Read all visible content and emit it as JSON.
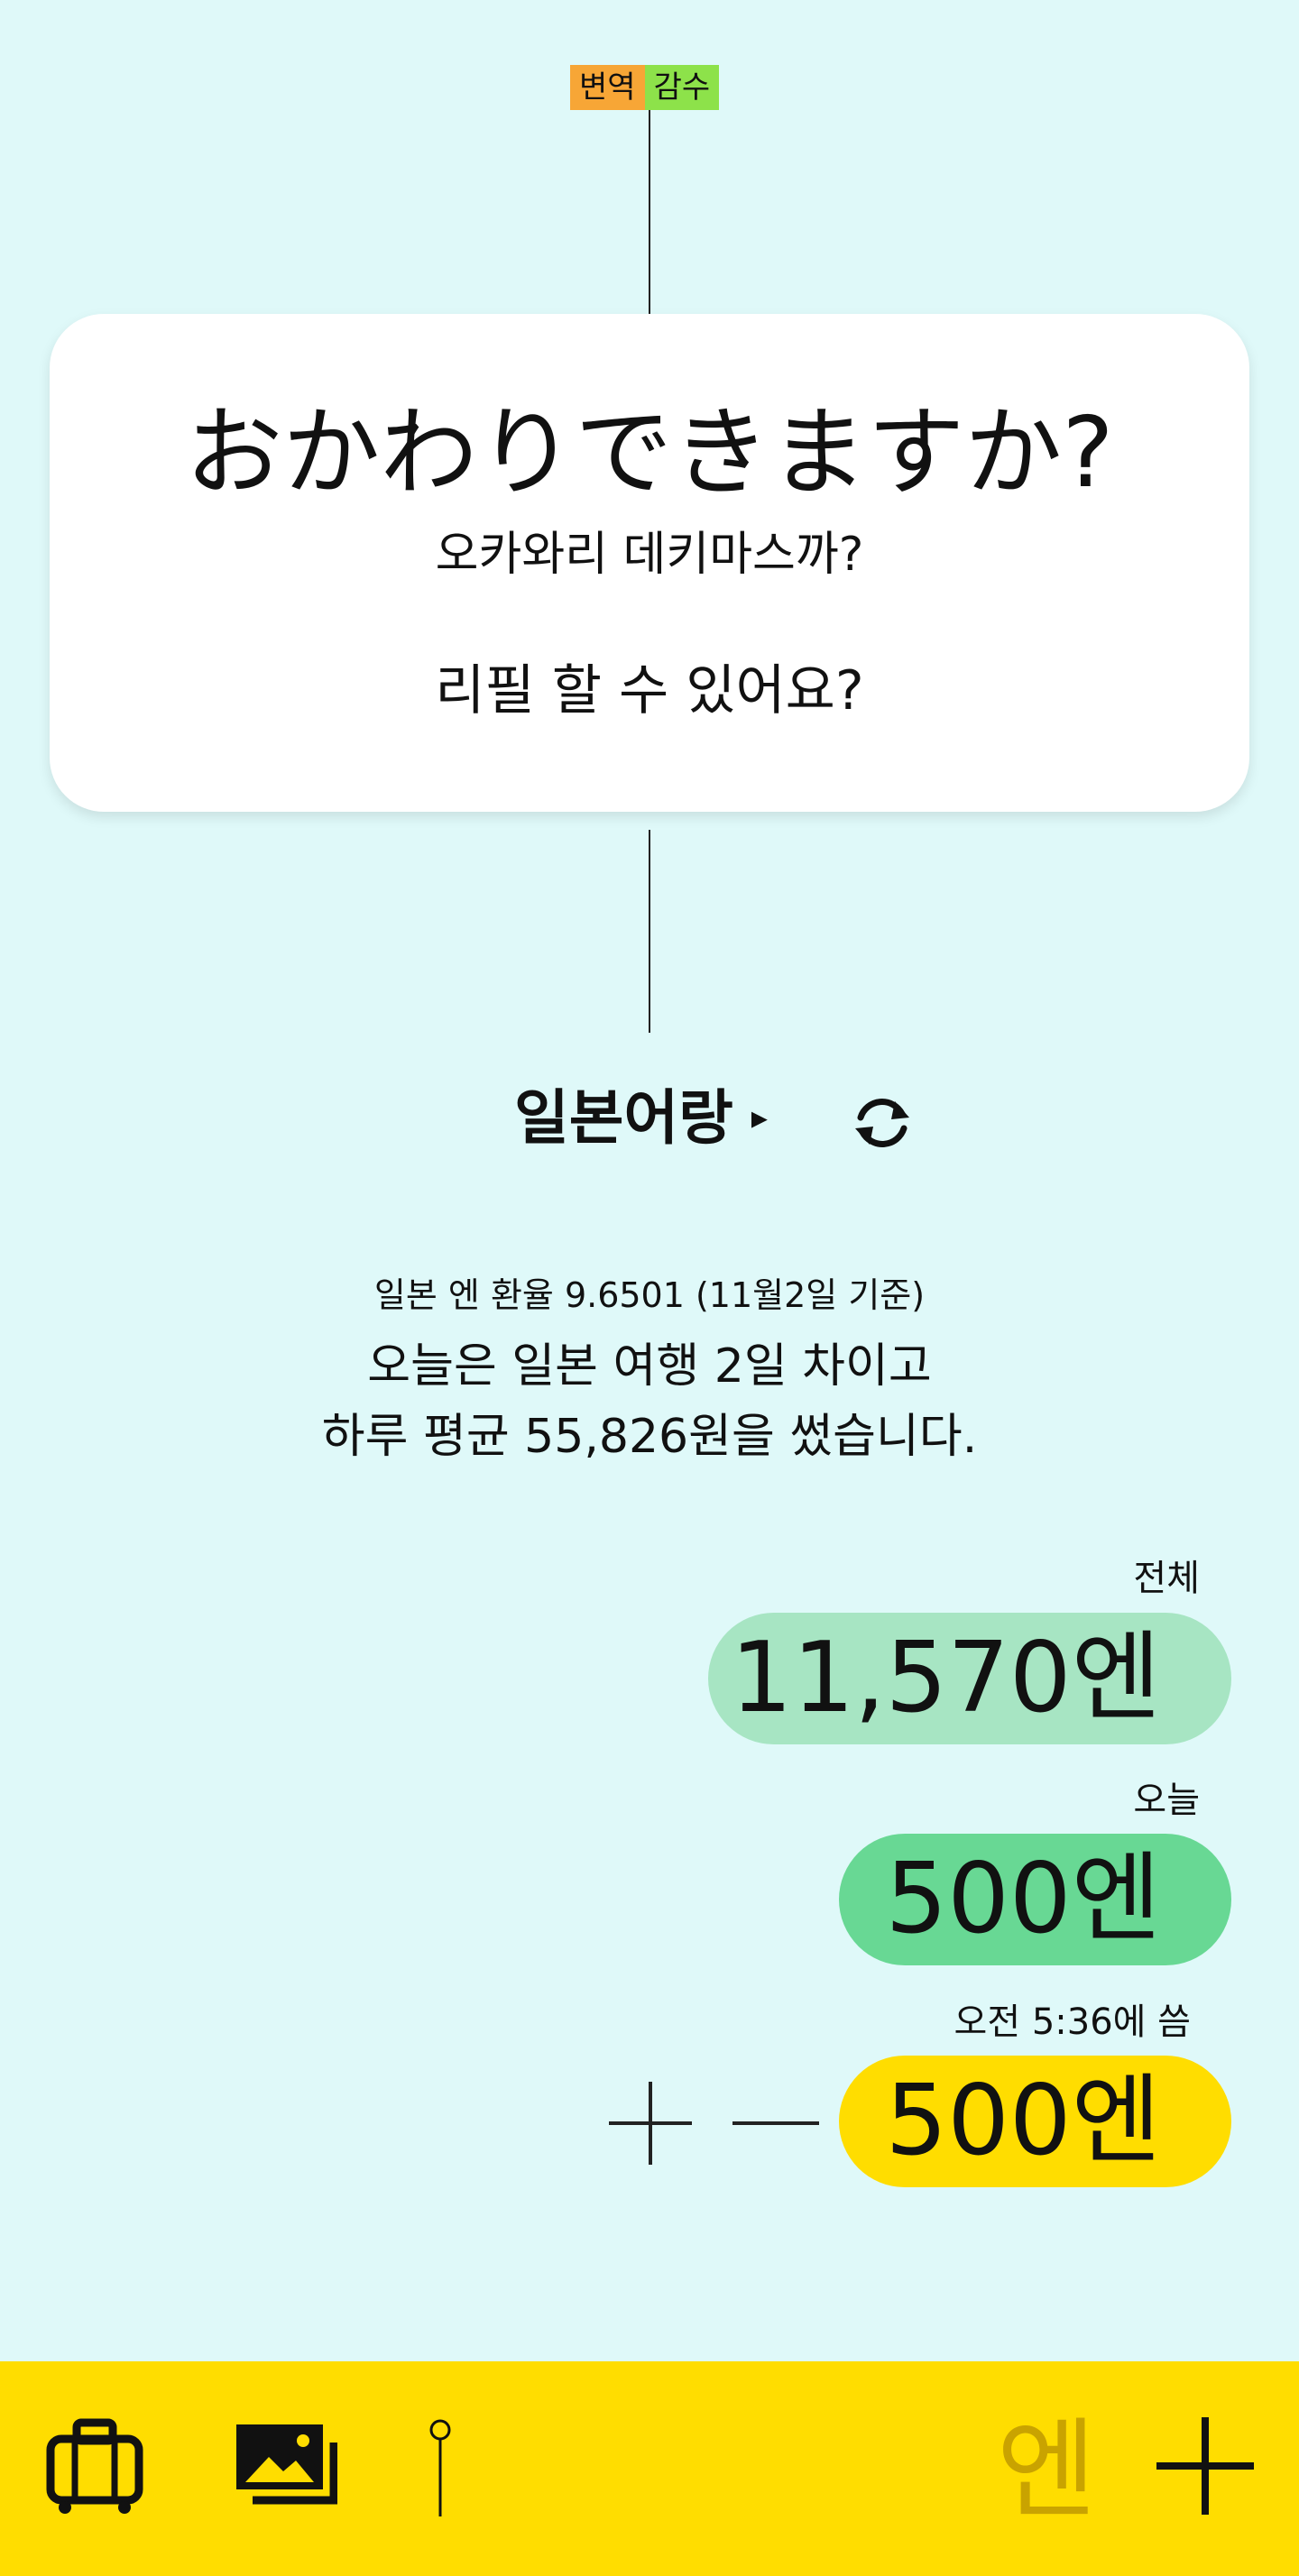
{
  "badges": {
    "translation": "변역",
    "review": "감수"
  },
  "phrase": {
    "japanese": "おかわりできますか?",
    "reading": "오카와리 데키마스까?",
    "meaning": "리필 할 수 있어요?"
  },
  "language": {
    "label": "일본어랑",
    "arrow": "▸"
  },
  "info": {
    "rate": "일본 엔 환율 9.6501 (11월2일 기준)",
    "line1": "오늘은 일본 여행 2일 차이고",
    "line2": "하루 평균 55,826원을 썼습니다."
  },
  "totals": {
    "total_label": "전체",
    "total_value": "11,570엔",
    "today_label": "오늘",
    "today_value": "500엔",
    "entry_label": "오전 5:36에 씀",
    "entry_value": "500엔"
  },
  "bottombar": {
    "currency": "엔"
  },
  "icons": [
    "suitcase-icon",
    "photos-icon",
    "pin-icon",
    "plus-icon",
    "minus-icon",
    "refresh-icon"
  ],
  "colors": {
    "background": "#dff9f9",
    "accent_yellow": "#ffdd00",
    "total_pill": "#a7e5c3",
    "today_pill": "#68d894",
    "badge_orange": "#f7a636",
    "badge_green": "#8de24a"
  }
}
